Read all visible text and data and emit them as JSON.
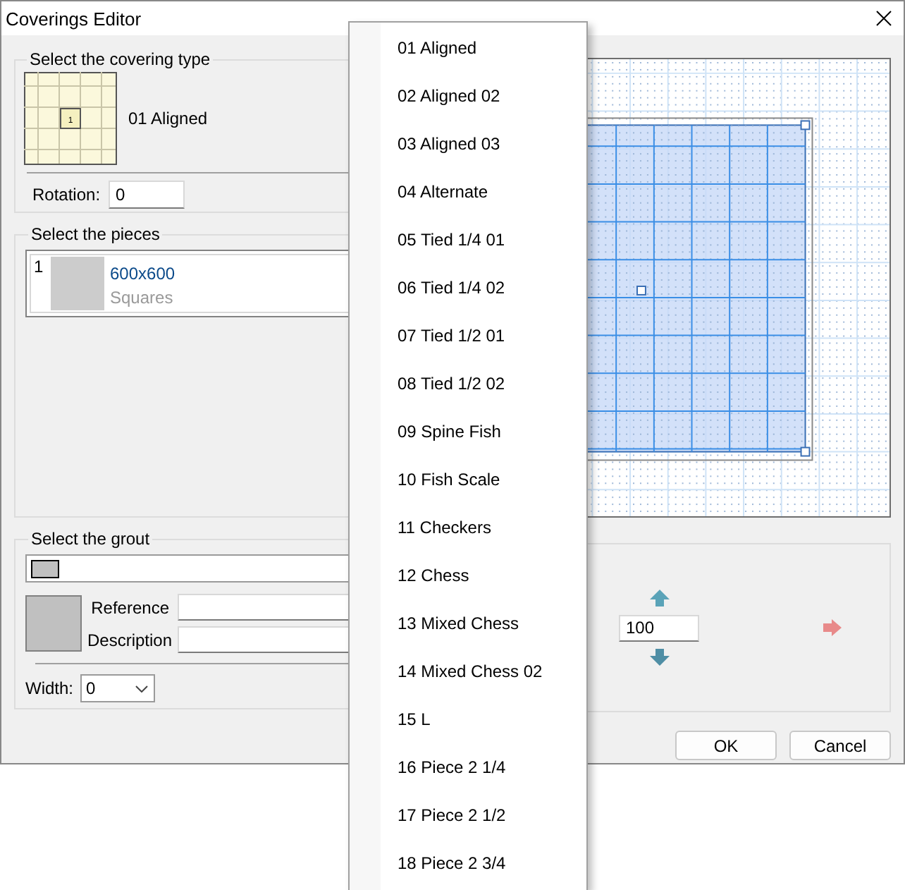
{
  "window": {
    "title": "Coverings Editor"
  },
  "covering_type": {
    "label": "Select the covering type",
    "thumbnail_number": "1",
    "name": "01 Aligned",
    "rotation_label": "Rotation:",
    "rotation_value": "0"
  },
  "pieces": {
    "label": "Select the pieces",
    "items": [
      {
        "number": "1",
        "size": "600x600",
        "shape": "Squares"
      }
    ]
  },
  "grout": {
    "label": "Select the grout",
    "reference_label": "Reference",
    "description_label": "Description",
    "width_label": "Width:",
    "width_value": "0"
  },
  "zoom": {
    "value": "100"
  },
  "buttons": [
    {
      "label": "OK"
    },
    {
      "label": "Cancel"
    }
  ],
  "dropdown": {
    "options": [
      {
        "label": "01 Aligned"
      },
      {
        "label": "02 Aligned 02"
      },
      {
        "label": "03 Aligned 03"
      },
      {
        "label": "04 Alternate"
      },
      {
        "label": "05 Tied 1/4 01"
      },
      {
        "label": "06 Tied 1/4 02"
      },
      {
        "label": "07 Tied 1/2 01"
      },
      {
        "label": "08 Tied 1/2 02"
      },
      {
        "label": "09 Spine Fish"
      },
      {
        "label": "10 Fish Scale"
      },
      {
        "label": "11 Checkers"
      },
      {
        "label": "12 Chess"
      },
      {
        "label": "13 Mixed Chess"
      },
      {
        "label": "14 Mixed Chess 02"
      },
      {
        "label": "15 L"
      },
      {
        "label": "16 Piece 2 1/4"
      },
      {
        "label": "17 Piece 2 1/2"
      },
      {
        "label": "18 Piece 2 3/4"
      }
    ]
  }
}
